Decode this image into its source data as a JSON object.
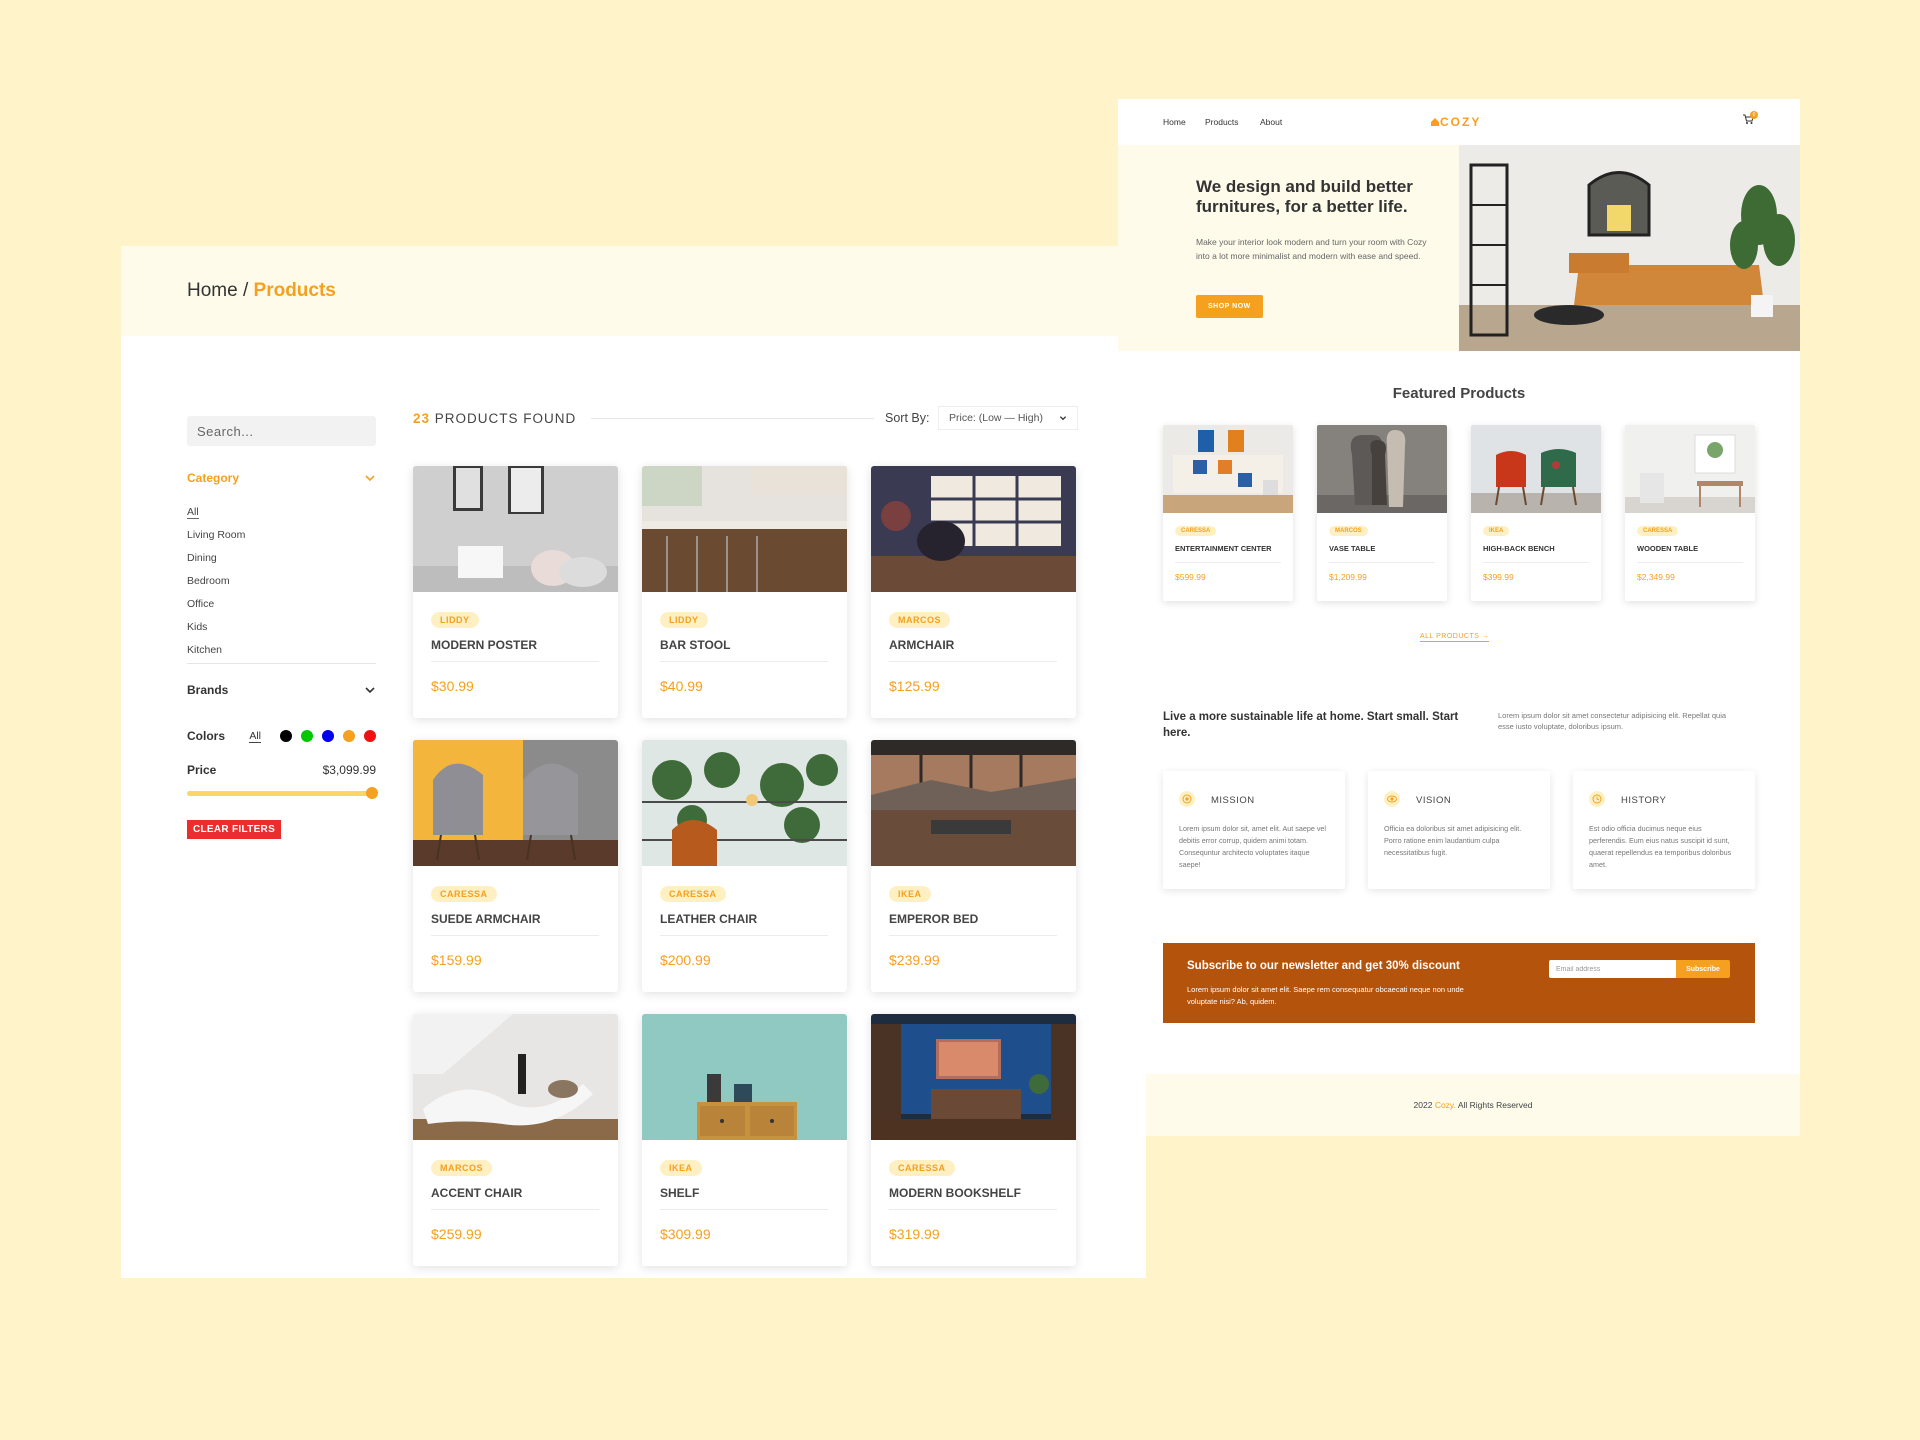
{
  "products_page": {
    "breadcrumb": {
      "home": "Home",
      "separator": "/",
      "current": "Products"
    },
    "search": {
      "placeholder": "Search..."
    },
    "filters": {
      "category_title": "Category",
      "categories": [
        "All",
        "Living Room",
        "Dining",
        "Bedroom",
        "Office",
        "Kids",
        "Kitchen"
      ],
      "selected_category": "All",
      "brands_title": "Brands",
      "colors_title": "Colors",
      "colors_all": "All",
      "colors": [
        "#000000",
        "#00c800",
        "#0000ee",
        "#f5a01e",
        "#ee1111"
      ],
      "price_title": "Price",
      "price_value": "$3,099.99",
      "price_slider_fraction": 1.0,
      "clear_button": "CLEAR FILTERS"
    },
    "results": {
      "count": "23",
      "label": "PRODUCTS FOUND"
    },
    "sort": {
      "label": "Sort By:",
      "value": "Price: (Low — High)"
    },
    "products": [
      {
        "brand": "LIDDY",
        "name": "MODERN POSTER",
        "price": "$30.99"
      },
      {
        "brand": "LIDDY",
        "name": "BAR STOOL",
        "price": "$40.99"
      },
      {
        "brand": "MARCOS",
        "name": "ARMCHAIR",
        "price": "$125.99"
      },
      {
        "brand": "CARESSA",
        "name": "SUEDE ARMCHAIR",
        "price": "$159.99"
      },
      {
        "brand": "CARESSA",
        "name": "LEATHER CHAIR",
        "price": "$200.99"
      },
      {
        "brand": "IKEA",
        "name": "EMPEROR BED",
        "price": "$239.99"
      },
      {
        "brand": "MARCOS",
        "name": "ACCENT CHAIR",
        "price": "$259.99"
      },
      {
        "brand": "IKEA",
        "name": "SHELF",
        "price": "$309.99"
      },
      {
        "brand": "CARESSA",
        "name": "MODERN BOOKSHELF",
        "price": "$319.99"
      }
    ]
  },
  "home_page": {
    "nav": {
      "links": [
        "Home",
        "Products",
        "About"
      ],
      "logo": "COZY",
      "cart_count": "0"
    },
    "hero": {
      "title": "We design and build better furnitures, for a better life.",
      "description": "Make your interior look modern and turn your room with Cozy into a lot more minimalist and modern with ease and speed.",
      "button": "SHOP NOW"
    },
    "featured": {
      "title": "Featured Products",
      "items": [
        {
          "brand": "CARESSA",
          "name": "ENTERTAINMENT CENTER",
          "price": "$599.99"
        },
        {
          "brand": "MARCOS",
          "name": "VASE TABLE",
          "price": "$1,209.99"
        },
        {
          "brand": "IKEA",
          "name": "HIGH-BACK BENCH",
          "price": "$399.99"
        },
        {
          "brand": "CARESSA",
          "name": "WOODEN TABLE",
          "price": "$2,349.99"
        }
      ],
      "all_link": "ALL PRODUCTS →"
    },
    "sustain": {
      "title": "Live a more sustainable life at home. Start small. Start here.",
      "description": "Lorem ipsum dolor sit amet consectetur adipisicing elit. Repellat quia esse iusto voluptate, doloribus ipsum."
    },
    "cards": [
      {
        "title": "MISSION",
        "text": "Lorem ipsum dolor sit, amet elit. Aut saepe vel debitis error corrup, quidem animi totam. Consequntur architecto voluptates itaque saepe!"
      },
      {
        "title": "VISION",
        "text": "Officia ea doloribus sit amet adipisicing elit. Porro ratione enim laudantium culpa necessitatibus fugit."
      },
      {
        "title": "HISTORY",
        "text": "Est odio officia ducimus neque eius perferendis. Eum eius natus suscipit id sunt, quaerat repellendus ea temporibus doloribus amet."
      }
    ],
    "newsletter": {
      "title": "Subscribe to our newsletter and get 30% discount",
      "description": "Lorem ipsum dolor sit amet elit. Saepe rem consequatur obcaecati neque non unde voluptate nisi? Ab, quidem.",
      "email_placeholder": "Email address",
      "button": "Subscribe"
    },
    "footer": {
      "year": "2022",
      "brand": "Cozy.",
      "rights": "All Rights Reserved"
    }
  }
}
